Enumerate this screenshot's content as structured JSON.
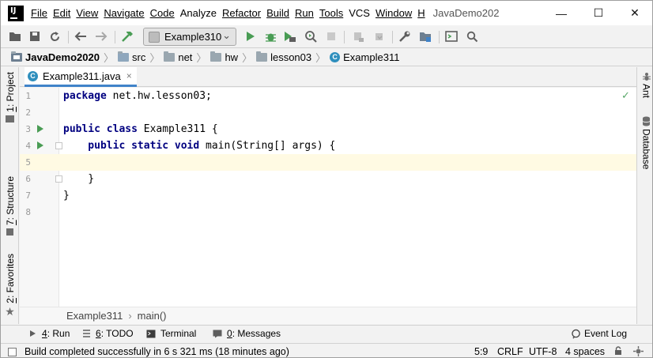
{
  "window": {
    "project_title": "JavaDemo202",
    "app_logo_text": "IJ",
    "controls": {
      "minimize": "—",
      "maximize": "☐",
      "close": "✕"
    }
  },
  "menu": [
    {
      "label": "File"
    },
    {
      "label": "Edit"
    },
    {
      "label": "View"
    },
    {
      "label": "Navigate"
    },
    {
      "label": "Code"
    },
    {
      "label": "Analyze"
    },
    {
      "label": "Refactor"
    },
    {
      "label": "Build"
    },
    {
      "label": "Run"
    },
    {
      "label": "Tools"
    },
    {
      "label": "VCS"
    },
    {
      "label": "Window"
    },
    {
      "label": "H"
    }
  ],
  "toolbar": {
    "run_configuration": "Example310",
    "dropdown_glyph": "⌄",
    "icons": [
      "open-folder-icon",
      "save-icon",
      "sync-icon",
      "back-arrow-icon",
      "forward-arrow-icon",
      "build-hammer-icon",
      "run-icon",
      "debug-icon",
      "run-coverage-icon",
      "profile-icon",
      "stop-icon",
      "attach-icon",
      "update-icon",
      "settings-wrench-icon",
      "project-structure-icon",
      "terminal-window-icon",
      "search-icon"
    ]
  },
  "navbar": {
    "crumbs": [
      {
        "label": "JavaDemo2020",
        "kind": "project"
      },
      {
        "label": "src",
        "kind": "folder"
      },
      {
        "label": "net",
        "kind": "folder"
      },
      {
        "label": "hw",
        "kind": "folder"
      },
      {
        "label": "lesson03",
        "kind": "folder"
      },
      {
        "label": "Example311",
        "kind": "class"
      }
    ],
    "class_glyph": "C",
    "separator": "〉"
  },
  "left_tools": {
    "project": {
      "num": "1",
      "label": ": Project"
    },
    "structure": {
      "num": "7",
      "label": ": Structure"
    },
    "favorites": {
      "num": "2",
      "label": ": Favorites"
    },
    "star": "★"
  },
  "right_tools": {
    "ant": "Ant",
    "database": "Database"
  },
  "editor": {
    "tab": {
      "label": "Example311.java",
      "close": "×",
      "glyph": "C"
    },
    "inspection_status": "✓",
    "current_line": 5,
    "lines": [
      {
        "n": "1",
        "kw": "package",
        "text": " net.hw.lesson03;"
      },
      {
        "n": "2",
        "kw": "",
        "text": ""
      },
      {
        "n": "3",
        "kw": "public class",
        "text": " Example311 {"
      },
      {
        "n": "4",
        "kw": "    public static void",
        "text": " main(String[] args) {"
      },
      {
        "n": "5",
        "kw": "",
        "text": ""
      },
      {
        "n": "6",
        "kw": "",
        "text": "    }"
      },
      {
        "n": "7",
        "kw": "",
        "text": "}"
      },
      {
        "n": "8",
        "kw": "",
        "text": ""
      }
    ],
    "breadcrumb": {
      "cls": "Example311",
      "sep": "›",
      "method": "main()"
    }
  },
  "bottom_tools": {
    "run": {
      "num": "4",
      "label": ": Run"
    },
    "todo": {
      "num": "6",
      "label": ": TODO"
    },
    "terminal": {
      "label": "Terminal"
    },
    "messages": {
      "num": "0",
      "label": ": Messages"
    },
    "event_log": {
      "label": "Event Log"
    }
  },
  "statusbar": {
    "message": "Build completed successfully in 6 s 321 ms (18 minutes ago)",
    "position": "5:9",
    "line_separator": "CRLF",
    "encoding": "UTF-8",
    "indent": "4 spaces"
  }
}
